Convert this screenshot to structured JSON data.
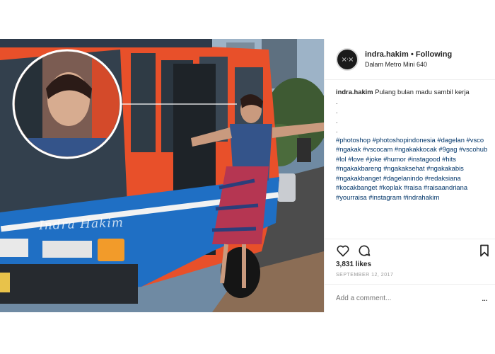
{
  "post": {
    "watermark": "Indra Hakim",
    "header": {
      "username": "indra.hakim",
      "separator": " • ",
      "follow_status": "Following",
      "location": "Dalam Metro Mini 640",
      "avatar_glyph": "×·×"
    },
    "caption": {
      "username": "indra.hakim",
      "text": " Pulang bulan madu sambil kerja",
      "dots": [
        ".",
        ".",
        ".",
        "."
      ],
      "hashtags": "#photoshop #photoshopindonesia #dagelan #vsco #ngakak #vscocam #ngakakkocak #9gag #vscohub #lol #love #joke #humor #instagood #hits #ngakakbareng #ngakaksehat #ngakakabis #ngakakbanget #dagelanindo #redaksiana #kocakbanget #koplak #raisa #raisaandriana #yourraisa #instagram #indrahakim"
    },
    "actions": {
      "icons": [
        "heart-icon",
        "comment-icon",
        "bookmark-icon"
      ]
    },
    "likes": "3,831 likes",
    "date": "SEPTEMBER 12, 2017",
    "comment": {
      "placeholder": "Add a comment...",
      "more": "..."
    },
    "colors": {
      "bus_orange": "#e8502a",
      "bus_blue": "#1f6fc4",
      "link": "#003569",
      "border": "#efefef"
    }
  }
}
